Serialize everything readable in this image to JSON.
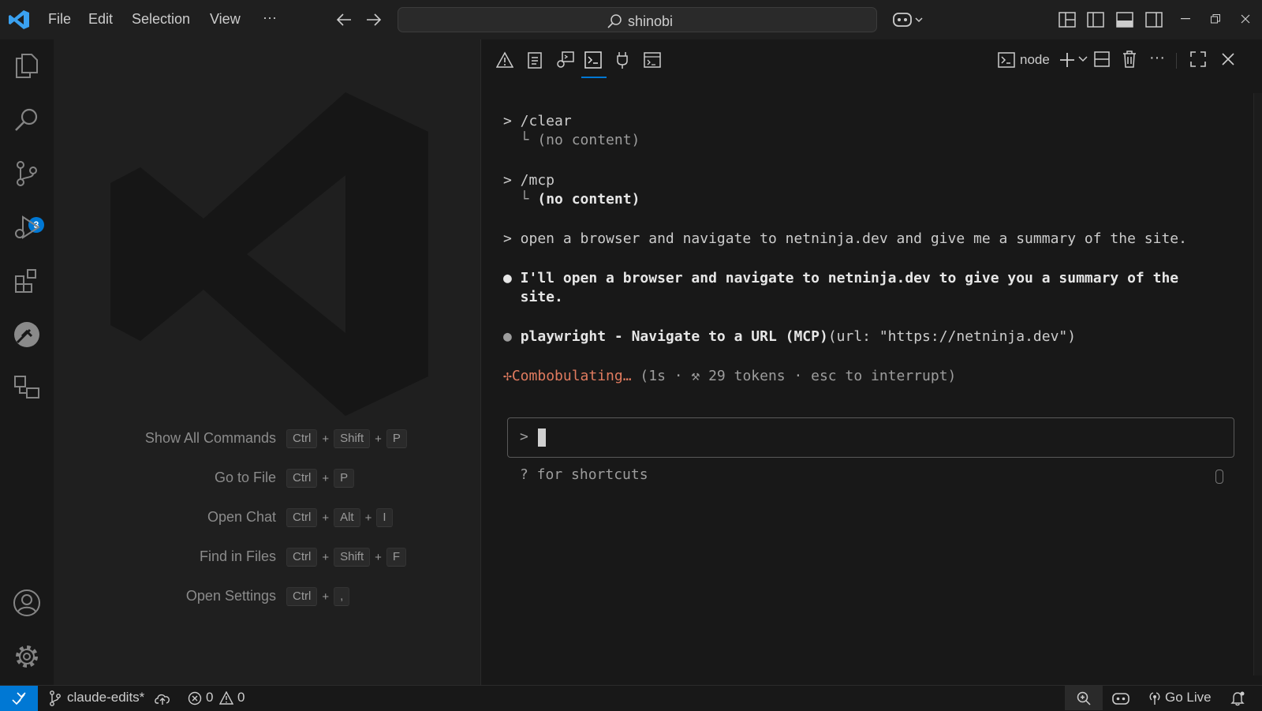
{
  "titlebar": {
    "menus": [
      "File",
      "Edit",
      "Selection",
      "View",
      "···"
    ],
    "search_text": "shinobi"
  },
  "activity_bar": {
    "scm_badge": "3"
  },
  "editor": {
    "shortcuts": [
      {
        "label": "Show All Commands",
        "keys": [
          "Ctrl",
          "Shift",
          "P"
        ]
      },
      {
        "label": "Go to File",
        "keys": [
          "Ctrl",
          "P"
        ]
      },
      {
        "label": "Open Chat",
        "keys": [
          "Ctrl",
          "Alt",
          "I"
        ]
      },
      {
        "label": "Find in Files",
        "keys": [
          "Ctrl",
          "Shift",
          "F"
        ]
      },
      {
        "label": "Open Settings",
        "keys": [
          "Ctrl",
          ","
        ]
      }
    ]
  },
  "panel": {
    "terminal_name": "node",
    "lines": {
      "clear_cmd": "> /clear",
      "clear_result": "  └ (no content)",
      "mcp_cmd": "> /mcp",
      "mcp_result_prefix": "  └ ",
      "mcp_result": "(no content)",
      "user_prompt": "> open a browser and navigate to netninja.dev and give me a summary of the site.",
      "assistant_1": "● I'll open a browser and navigate to netninja.dev to give you a summary of the",
      "assistant_1b": "  site.",
      "tool_bullet": "● ",
      "tool_name": "playwright - Navigate to a URL (MCP)",
      "tool_args": "(url: \"https://netninja.dev\")",
      "status_icon": "✢",
      "status_word": "Combobulating…",
      "status_detail": " (1s · ⚒ 29 tokens · esc to interrupt)",
      "input_prompt": ">",
      "shortcuts_hint": "? for shortcuts"
    }
  },
  "statusbar": {
    "branch": "claude-edits*",
    "errors": "0",
    "warnings": "0",
    "go_live": "Go Live"
  }
}
